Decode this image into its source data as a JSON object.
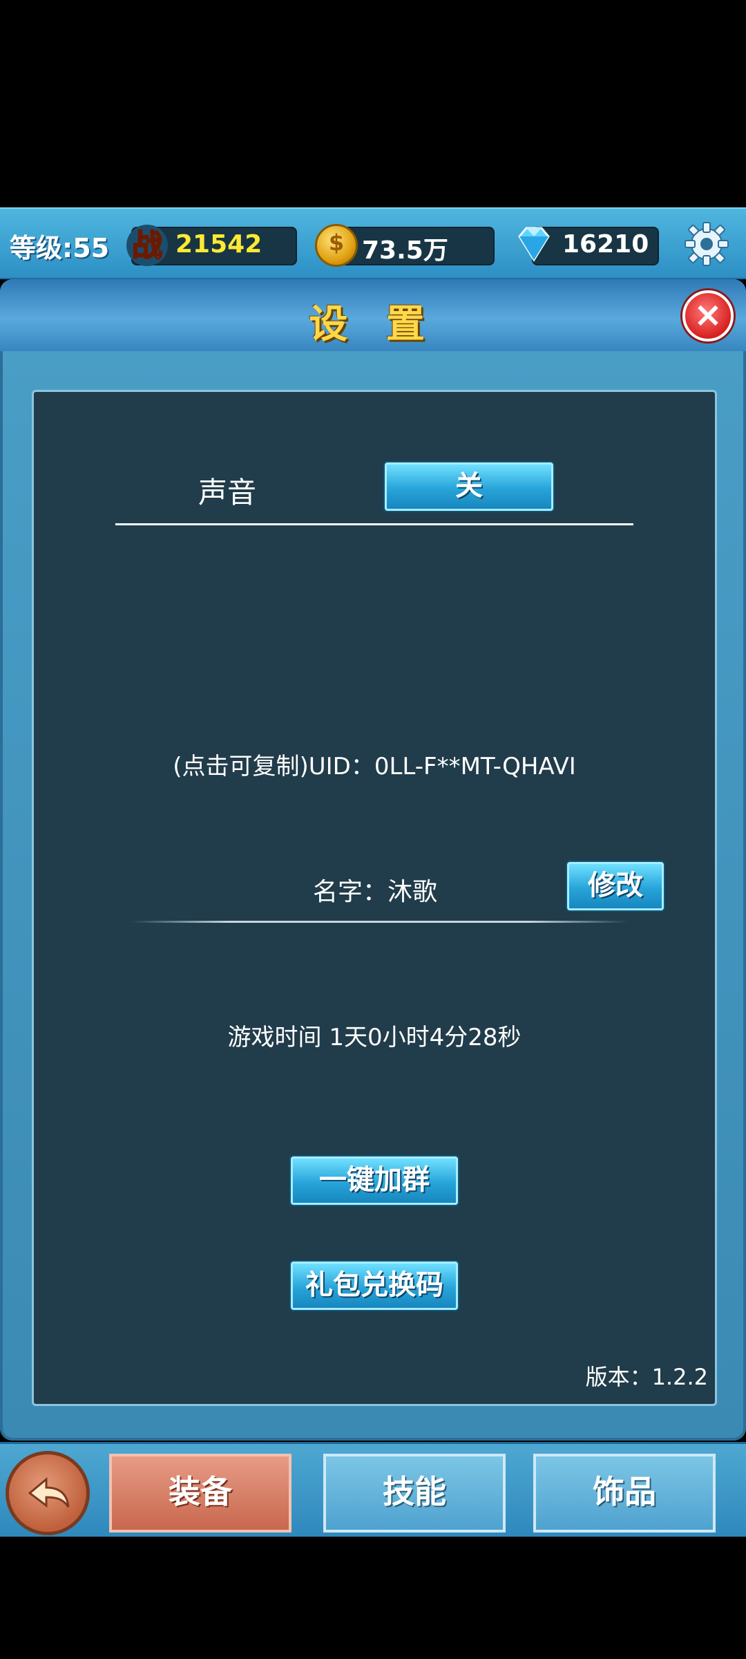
{
  "topbar": {
    "level": "等级:55",
    "power_badge": "战",
    "power": "21542",
    "gold": "73.5万",
    "gems": "16210"
  },
  "panel": {
    "title": "设 置",
    "sound": {
      "label": "声音",
      "toggle": "关"
    },
    "uid_text": "(点击可复制)UID：0LL-F**MT-QHAVI",
    "name_text": "名字：沐歌",
    "rename_button": "修改",
    "play_time": "游戏时间 1天0小时4分28秒",
    "join_group_button": "一键加群",
    "gift_code_button": "礼包兑换码",
    "version": "版本：1.2.2"
  },
  "tabs": [
    "装备",
    "技能",
    "饰品"
  ],
  "icons": [
    "power-icon",
    "gold-coin-icon",
    "diamond-icon",
    "gear-icon",
    "close-icon",
    "back-arrow-icon"
  ],
  "colors": {
    "accent_gold": "#ffd84a",
    "panel_bg": "#213c4a",
    "active_tab": "#d07a5e"
  }
}
